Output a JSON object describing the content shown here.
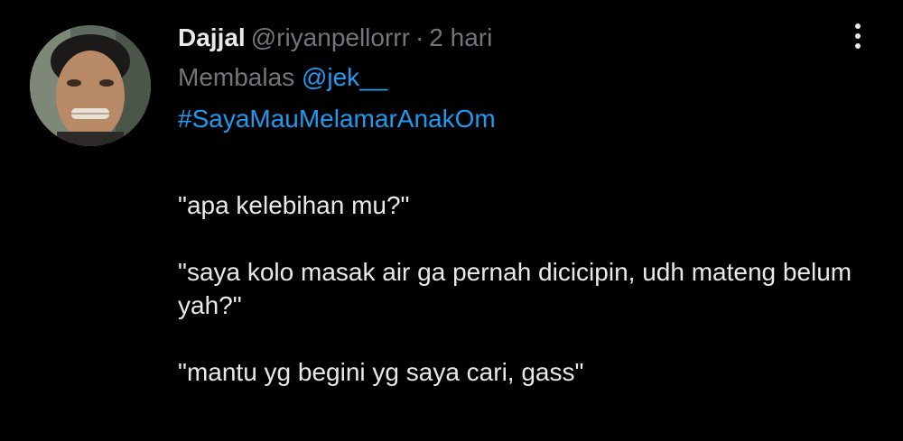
{
  "tweet": {
    "author_name": "Dajjal",
    "handle": "@riyanpellorrr",
    "separator": "·",
    "time": "2 hari",
    "reply_prefix": "Membalas",
    "reply_to": "@jek__",
    "hashtag": "#SayaMauMelamarAnakOm",
    "paragraphs": [
      "\"apa kelebihan mu?\"",
      "\"saya kolo masak air ga pernah dicicipin, udh mateng belum yah?\"",
      "\"mantu yg begini yg saya cari, gass\""
    ]
  },
  "icons": {
    "more": "more-vertical-icon",
    "avatar": "avatar"
  },
  "colors": {
    "background": "#000000",
    "text": "#e7e9ea",
    "secondary": "#71767b",
    "link": "#1d9bf0"
  }
}
